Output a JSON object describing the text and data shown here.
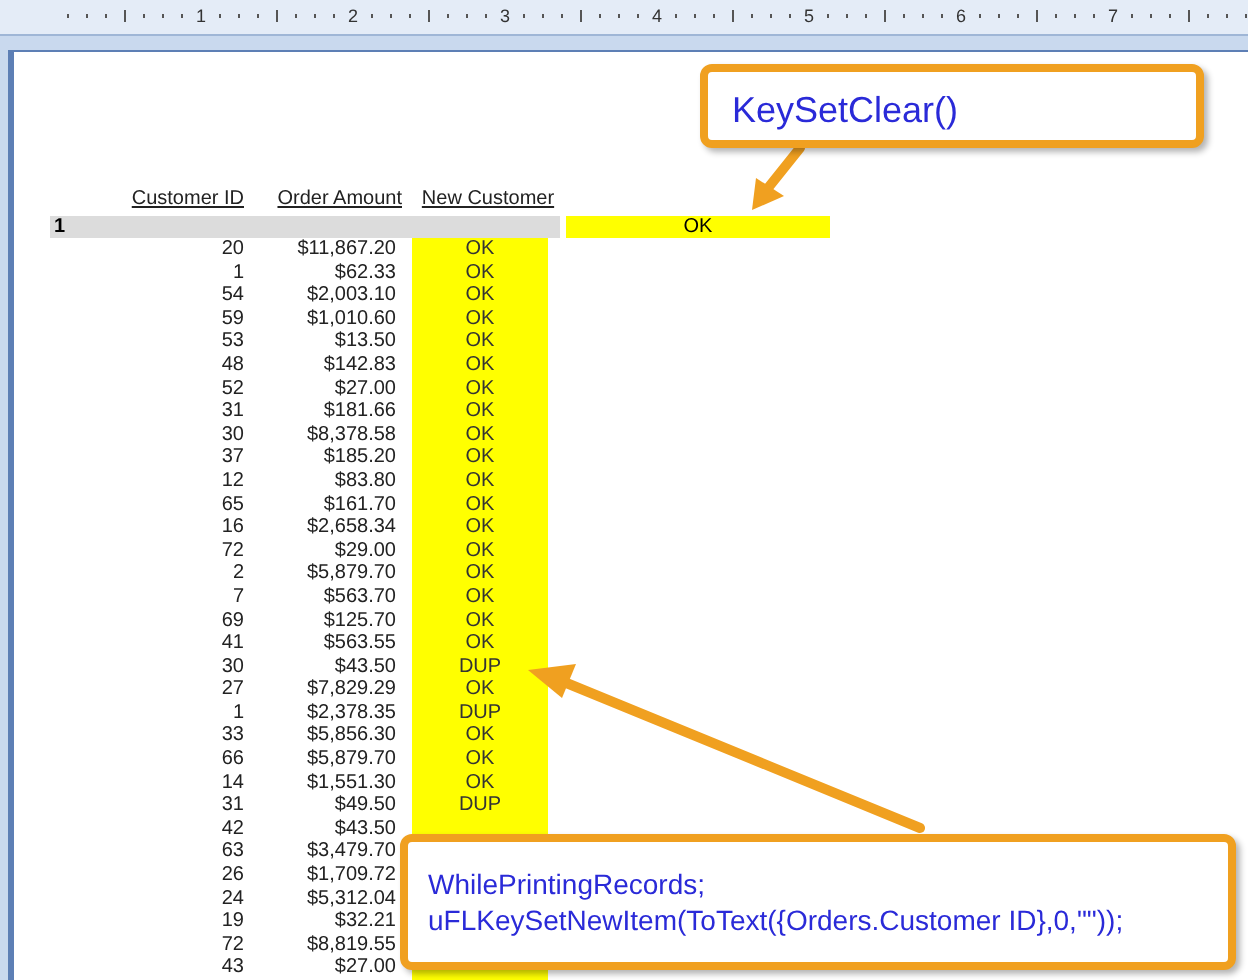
{
  "ruler": {
    "marks": [
      "1",
      "2",
      "3",
      "4",
      "5",
      "6",
      "7"
    ]
  },
  "report": {
    "columns": [
      "Customer ID",
      "Order Amount",
      "New Customer"
    ],
    "group": {
      "label": "1",
      "value": "OK"
    },
    "rows": [
      {
        "customer_id": "20",
        "order_amount": "$11,867.20",
        "new_customer": "OK"
      },
      {
        "customer_id": "1",
        "order_amount": "$62.33",
        "new_customer": "OK"
      },
      {
        "customer_id": "54",
        "order_amount": "$2,003.10",
        "new_customer": "OK"
      },
      {
        "customer_id": "59",
        "order_amount": "$1,010.60",
        "new_customer": "OK"
      },
      {
        "customer_id": "53",
        "order_amount": "$13.50",
        "new_customer": "OK"
      },
      {
        "customer_id": "48",
        "order_amount": "$142.83",
        "new_customer": "OK"
      },
      {
        "customer_id": "52",
        "order_amount": "$27.00",
        "new_customer": "OK"
      },
      {
        "customer_id": "31",
        "order_amount": "$181.66",
        "new_customer": "OK"
      },
      {
        "customer_id": "30",
        "order_amount": "$8,378.58",
        "new_customer": "OK"
      },
      {
        "customer_id": "37",
        "order_amount": "$185.20",
        "new_customer": "OK"
      },
      {
        "customer_id": "12",
        "order_amount": "$83.80",
        "new_customer": "OK"
      },
      {
        "customer_id": "65",
        "order_amount": "$161.70",
        "new_customer": "OK"
      },
      {
        "customer_id": "16",
        "order_amount": "$2,658.34",
        "new_customer": "OK"
      },
      {
        "customer_id": "72",
        "order_amount": "$29.00",
        "new_customer": "OK"
      },
      {
        "customer_id": "2",
        "order_amount": "$5,879.70",
        "new_customer": "OK"
      },
      {
        "customer_id": "7",
        "order_amount": "$563.70",
        "new_customer": "OK"
      },
      {
        "customer_id": "69",
        "order_amount": "$125.70",
        "new_customer": "OK"
      },
      {
        "customer_id": "41",
        "order_amount": "$563.55",
        "new_customer": "OK"
      },
      {
        "customer_id": "30",
        "order_amount": "$43.50",
        "new_customer": "DUP"
      },
      {
        "customer_id": "27",
        "order_amount": "$7,829.29",
        "new_customer": "OK"
      },
      {
        "customer_id": "1",
        "order_amount": "$2,378.35",
        "new_customer": "DUP"
      },
      {
        "customer_id": "33",
        "order_amount": "$5,856.30",
        "new_customer": "OK"
      },
      {
        "customer_id": "66",
        "order_amount": "$5,879.70",
        "new_customer": "OK"
      },
      {
        "customer_id": "14",
        "order_amount": "$1,551.30",
        "new_customer": "OK"
      },
      {
        "customer_id": "31",
        "order_amount": "$49.50",
        "new_customer": "DUP"
      },
      {
        "customer_id": "42",
        "order_amount": "$43.50"
      },
      {
        "customer_id": "63",
        "order_amount": "$3,479.70"
      },
      {
        "customer_id": "26",
        "order_amount": "$1,709.72"
      },
      {
        "customer_id": "24",
        "order_amount": "$5,312.04"
      },
      {
        "customer_id": "19",
        "order_amount": "$32.21"
      },
      {
        "customer_id": "72",
        "order_amount": "$8,819.55"
      },
      {
        "customer_id": "43",
        "order_amount": "$27.00"
      }
    ]
  },
  "callouts": [
    {
      "kind": "single",
      "lines": [
        "KeySetClear()"
      ]
    },
    {
      "kind": "code",
      "lines": [
        "WhilePrintingRecords;",
        "uFLKeySetNewItem(ToText({Orders.Customer ID},0,\"\"));"
      ]
    }
  ]
}
